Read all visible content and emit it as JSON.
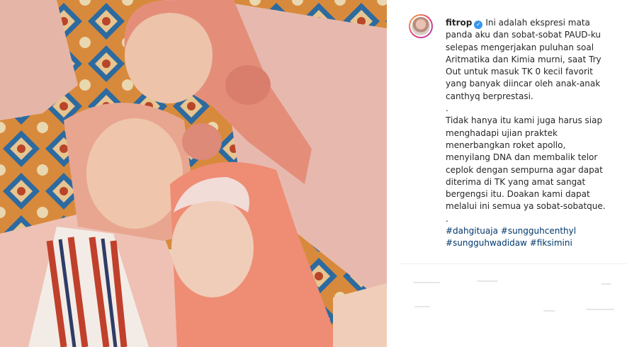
{
  "post": {
    "username": "fitrop",
    "caption_lines": [
      "Ini adalah ekspresi mata",
      "panda aku dan sobat-sobat PAUD-ku",
      "selepas mengerjakan puluhan soal",
      "Aritmatika dan Kimia murni, saat Try",
      "Out untuk masuk TK 0 kecil favorit",
      "yang banyak diincar oleh anak-anak",
      "canthyq berprestasi.",
      ".",
      "Tidak hanya itu kami juga harus siap",
      "menghadapi ujian praktek",
      "menerbangkan roket apollo,",
      "menyilang DNA dan membalik telor",
      "ceplok dengan sempurna agar dapat",
      "diterima di TK yang amat sangat",
      "bergengsi itu. Doakan kami dapat",
      "melalui ini semua ya sobat-sobatque.",
      "."
    ],
    "hashtags_line1": [
      "#dahgituaja",
      "#sungguhcenthyl"
    ],
    "hashtags_line2": [
      "#sungguhwadidaw",
      "#fiksimini"
    ],
    "verified_icon": "verified-badge-icon",
    "colors": {
      "hashtag": "#00376b",
      "verified": "#3897f0",
      "text": "#262626"
    }
  }
}
